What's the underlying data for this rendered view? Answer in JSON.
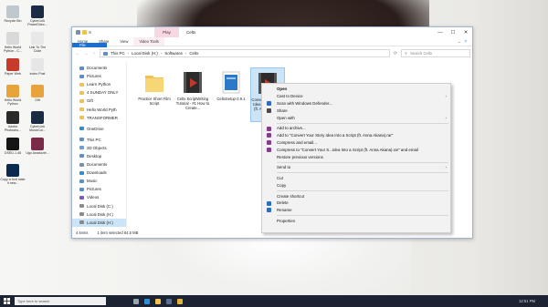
{
  "window": {
    "title": "Celtx",
    "contextual_tab": "Play",
    "controls": {
      "minimize": "—",
      "maximize": "☐",
      "close": "✕"
    }
  },
  "ribbon": {
    "tabs": [
      "File",
      "Home",
      "Share",
      "View",
      "Video Tools"
    ]
  },
  "address": {
    "back": "←",
    "forward": "→",
    "up": "↑",
    "path": [
      "This PC",
      "Local Disk (H:)",
      "Softwares",
      "Celtx"
    ],
    "search_placeholder": "Search Celtx"
  },
  "nav": [
    {
      "label": "Documents"
    },
    {
      "label": "Pictures"
    },
    {
      "label": "Learn Python"
    },
    {
      "label": "4 SUNDAY ONLY"
    },
    {
      "label": "Gift"
    },
    {
      "label": "Hello World Pyth"
    },
    {
      "label": "TRANSFORMER"
    },
    {
      "label": "OneDrive"
    },
    {
      "label": "This PC"
    },
    {
      "label": "3D Objects"
    },
    {
      "label": "Desktop"
    },
    {
      "label": "Documents"
    },
    {
      "label": "Downloads"
    },
    {
      "label": "Music"
    },
    {
      "label": "Pictures"
    },
    {
      "label": "Videos"
    },
    {
      "label": "Local Disk (C:)"
    },
    {
      "label": "Local Disk (H:)"
    },
    {
      "label": "Local Disk (H:)"
    }
  ],
  "files": [
    {
      "name": "Practice Short Film Script",
      "kind": "folder"
    },
    {
      "name": "Celtx ScriptWriting Tutorial - #1 How to Create...",
      "kind": "video"
    },
    {
      "name": "CeltxSetup-2.9.1",
      "kind": "installer"
    },
    {
      "name": "Convert Your Story Idea into a Script (ft. Anna Akana)",
      "kind": "video",
      "selected": true
    }
  ],
  "status": {
    "count": "4 items",
    "selection": "1 item selected 84.5 MB"
  },
  "context_menu": [
    {
      "label": "Open"
    },
    {
      "label": "Cast to Device",
      "submenu": true
    },
    {
      "label": "Scan with Windows Defender...",
      "icon": "#2b6cc4"
    },
    {
      "label": "Share",
      "icon": "#4a4a4a"
    },
    {
      "label": "Open with",
      "submenu": true
    },
    {
      "sep": true
    },
    {
      "label": "Add to archive...",
      "icon": "#8a3b8f"
    },
    {
      "label": "Add to \"Convert Your Story Idea Into a Script (ft. Anna Akana).rar\"",
      "icon": "#8a3b8f"
    },
    {
      "label": "Compress and email...",
      "icon": "#8a3b8f"
    },
    {
      "label": "Compress to \"Convert Your S...Idea Into a Script (ft. Anna Akana).rar\" and email",
      "icon": "#8a3b8f"
    },
    {
      "label": "Restore previous versions"
    },
    {
      "sep": true
    },
    {
      "label": "Send to",
      "submenu": true
    },
    {
      "sep": true
    },
    {
      "label": "Cut"
    },
    {
      "label": "Copy"
    },
    {
      "sep": true
    },
    {
      "label": "Create shortcut"
    },
    {
      "label": "Delete",
      "icon": "#2b6cc4"
    },
    {
      "label": "Rename",
      "icon": "#2b6cc4"
    },
    {
      "sep": true
    },
    {
      "label": "Properties"
    }
  ],
  "desktop_icons": [
    {
      "label": "Recycle Bin",
      "color": "#bfc7cf"
    },
    {
      "label": "CyberLink PowerDirec...",
      "color": "#1b2b44"
    },
    {
      "label": "Hello World Python - C...",
      "color": "#d9d9d9"
    },
    {
      "label": "Link To The Code",
      "color": "#e8e8e8"
    },
    {
      "label": "Paper Web",
      "color": "#c83a2c"
    },
    {
      "label": "index Post",
      "color": "#e6e6e6"
    },
    {
      "label": "Hello World Python",
      "color": "#e8a43a"
    },
    {
      "label": "Gift",
      "color": "#e8a43a"
    },
    {
      "label": "Adobe Photosho...",
      "color": "#2a2a2a"
    },
    {
      "label": "CyberLink MusicCol...",
      "color": "#1b2b44"
    },
    {
      "label": "DSED-1.46",
      "color": "#151515"
    },
    {
      "label": "Ugo Anadozie...",
      "color": "#7a2b4a"
    },
    {
      "label": "Copy a font makr it new...",
      "color": "#0b2a4d"
    }
  ],
  "taskbar": {
    "search_placeholder": "Type here to search",
    "clock": "12:51 PM"
  },
  "colors": {
    "accent": "#1a6fd0",
    "selection": "#cce4f7",
    "contextual_tab": "#f5d8e2",
    "folder": "#f3c24c",
    "taskbar": "#1c2433"
  }
}
